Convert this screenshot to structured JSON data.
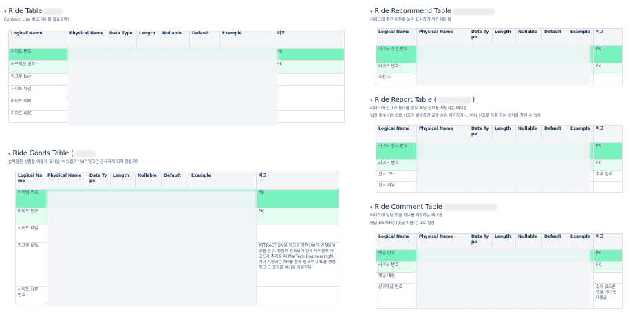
{
  "headers": [
    "Logical Name",
    "Physical Name",
    "Data Type",
    "Length",
    "Nullable",
    "Default",
    "Example",
    "비고"
  ],
  "ride_table": {
    "title": "Ride Table",
    "desc": "Content. Like 별도 테이블 필요할까?",
    "rows": [
      {
        "name": "라이드 번호",
        "remark": "PK"
      },
      {
        "name": "어트랙션 번호",
        "remark": "FK"
      },
      {
        "name": "링크루 Key",
        "remark": ""
      },
      {
        "name": "사이트 타입",
        "remark": ""
      },
      {
        "name": "라이드 제목",
        "remark": ""
      },
      {
        "name": "라이드 내용",
        "remark": ""
      }
    ]
  },
  "goods_table": {
    "title": "Ride Goods Table (",
    "desc": "숭력들은 상품을 어떻게 찾아낼 수 있을까? VIP 링크만 공유하게 되지 않을까?",
    "rows": [
      {
        "name": "아이템 번호",
        "remark": "PK"
      },
      {
        "name": "라이드 번호",
        "remark": "FK"
      },
      {
        "name": "사이트 타입",
        "remark": ""
      },
      {
        "name": "링크루 URL",
        "remark": "ATTRACTION에 링크루 정책인보가 연결되어 있을 경우, 상품이 등록되어 현재 테이블에 레코드가 추가될 때 MarTech Engineering팀에서 지공하는 API를 통해 링크루 URL을 생성하고 그 결과를 여기에 기록한다."
      },
      {
        "name": "사이트 상품 번호",
        "remark": ""
      }
    ]
  },
  "recommend_table": {
    "title": "Ride Recommend Table",
    "desc": "라이드에 추천 버튼을 눌러 표시하기 위한 테이블",
    "rows": [
      {
        "name": "라이드 추천 번호",
        "remark": "PK"
      },
      {
        "name": "라이드 번호",
        "remark": "FK"
      },
      {
        "name": "추천 수",
        "remark": ""
      }
    ]
  },
  "report_table": {
    "title": "Ride Report Table (",
    "title_end": ")",
    "desc1": "라이드에 신고가 들어올 경우 해당 정보를 저장하는 테이블",
    "desc2": "일정 횟수 이상으로 신고가 발생하면 글을 숨김 처리하거나, 허위 신고를 자주 하는 송력을 찾던 수 있음",
    "rows": [
      {
        "name": "라이드 신고 번호",
        "remark": "PK"
      },
      {
        "name": "라이드 번호",
        "remark": "FK"
      },
      {
        "name": "신고 코드",
        "remark": "추후 정리"
      },
      {
        "name": "신고 사유",
        "remark": ""
      }
    ]
  },
  "comment_table": {
    "title": "Ride Comment Table",
    "desc1": "라이드에 달린 댓글 정보를 저장하는 테이블",
    "desc2": "댓글 DEPTH(대댓글 허용)는 1로 설정",
    "rows": [
      {
        "name": "댓글 번호",
        "remark": "PK"
      },
      {
        "name": "라이드 번호",
        "remark": "FK"
      },
      {
        "name": "댓글 내용",
        "remark": ""
      },
      {
        "name": "상위댓글 번호",
        "remark": "값이 없으면 댓글, 있으면 대댓글"
      }
    ]
  },
  "colors": {
    "pk": "#79f2c0",
    "fk": "#e3fcef",
    "header_bg": "#f4f5f7",
    "border": "#dfe1e6"
  }
}
